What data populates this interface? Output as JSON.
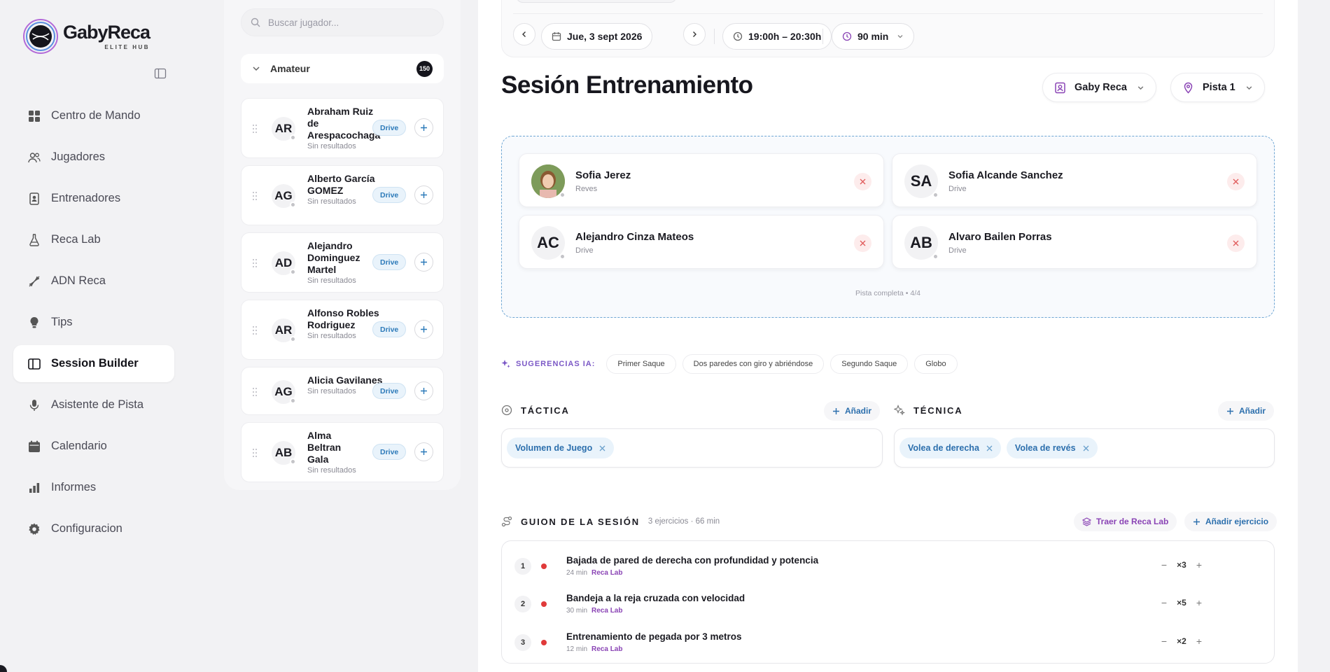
{
  "brand": {
    "name": "GabyReca",
    "subtitle": "ELITE HUB"
  },
  "sidebar": {
    "items": [
      {
        "label": "Centro de Mando",
        "icon": "grid-icon"
      },
      {
        "label": "Jugadores",
        "icon": "users-icon"
      },
      {
        "label": "Entrenadores",
        "icon": "badge-icon"
      },
      {
        "label": "Reca Lab",
        "icon": "flask-icon"
      },
      {
        "label": "ADN Reca",
        "icon": "dna-icon"
      },
      {
        "label": "Tips",
        "icon": "bulb-icon"
      },
      {
        "label": "Session Builder",
        "icon": "book-icon",
        "active": true
      },
      {
        "label": "Asistente de Pista",
        "icon": "mic-icon"
      },
      {
        "label": "Calendario",
        "icon": "calendar-icon"
      },
      {
        "label": "Informes",
        "icon": "bars-icon"
      },
      {
        "label": "Configuracion",
        "icon": "gear-icon"
      }
    ]
  },
  "players_panel": {
    "search_placeholder": "Buscar jugador...",
    "group": {
      "name": "Amateur",
      "count": "150"
    },
    "players": [
      {
        "initials": "AR",
        "name": "Abraham Ruiz de Arespacochaga",
        "sub": "Sin resultados",
        "tag": "Drive"
      },
      {
        "initials": "AG",
        "name": "Alberto García GOMEZ",
        "sub": "Sin resultados",
        "tag": "Drive"
      },
      {
        "initials": "AD",
        "name": "Alejandro Dominguez Martel",
        "sub": "Sin resultados",
        "tag": "Drive"
      },
      {
        "initials": "AR",
        "name": "Alfonso Robles Rodriguez",
        "sub": "Sin resultados",
        "tag": "Drive"
      },
      {
        "initials": "AG",
        "name": "Alicia Gavilanes",
        "sub": "Sin resultados",
        "tag": "Drive"
      },
      {
        "initials": "AB",
        "name": "Alma Beltran Gala",
        "sub": "Sin resultados",
        "tag": "Drive"
      }
    ]
  },
  "toolbar": {
    "date": "Jue, 3 sept 2026",
    "time": "19:00h – 20:30h",
    "duration": "90 min"
  },
  "session": {
    "title": "Sesión Entrenamiento",
    "coach": "Gaby Reca",
    "court": "Pista 1",
    "slots": [
      {
        "initials": "",
        "name": "Sofia Jerez",
        "role": "Reves",
        "photo": true
      },
      {
        "initials": "SA",
        "name": "Sofia Alcande Sanchez",
        "role": "Drive"
      },
      {
        "initials": "AC",
        "name": "Alejandro Cinza Mateos",
        "role": "Drive"
      },
      {
        "initials": "AB",
        "name": "Alvaro Bailen Porras",
        "role": "Drive"
      }
    ],
    "court_status": "Pista completa • 4/4"
  },
  "suggestions": {
    "label": "SUGERENCIAS IA:",
    "chips": [
      "Primer Saque",
      "Dos paredes con giro y abriéndose",
      "Segundo Saque",
      "Globo"
    ]
  },
  "tactica": {
    "title": "TÁCTICA",
    "add_label": "Añadir",
    "tags": [
      "Volumen de Juego"
    ]
  },
  "tecnica": {
    "title": "TÉCNICA",
    "add_label": "Añadir",
    "tags": [
      "Volea de derecha",
      "Volea de revés"
    ]
  },
  "script": {
    "title": "GUION DE LA SESIÓN",
    "meta": "3 ejercicios · 66 min",
    "bring_label": "Traer de Reca Lab",
    "add_label": "Añadir ejercicio",
    "exercises": [
      {
        "num": "1",
        "title": "Bajada de pared de derecha con profundidad y potencia",
        "duration": "24 min",
        "source": "Reca Lab",
        "reps": "×3"
      },
      {
        "num": "2",
        "title": "Bandeja a la reja cruzada con velocidad",
        "duration": "30 min",
        "source": "Reca Lab",
        "reps": "×5"
      },
      {
        "num": "3",
        "title": "Entrenamiento de pegada por 3 metros",
        "duration": "12 min",
        "source": "Reca Lab",
        "reps": "×2"
      }
    ]
  },
  "colors": {
    "accent": "#2c6fad",
    "purple": "#8a44b5",
    "danger": "#e03a3a"
  }
}
